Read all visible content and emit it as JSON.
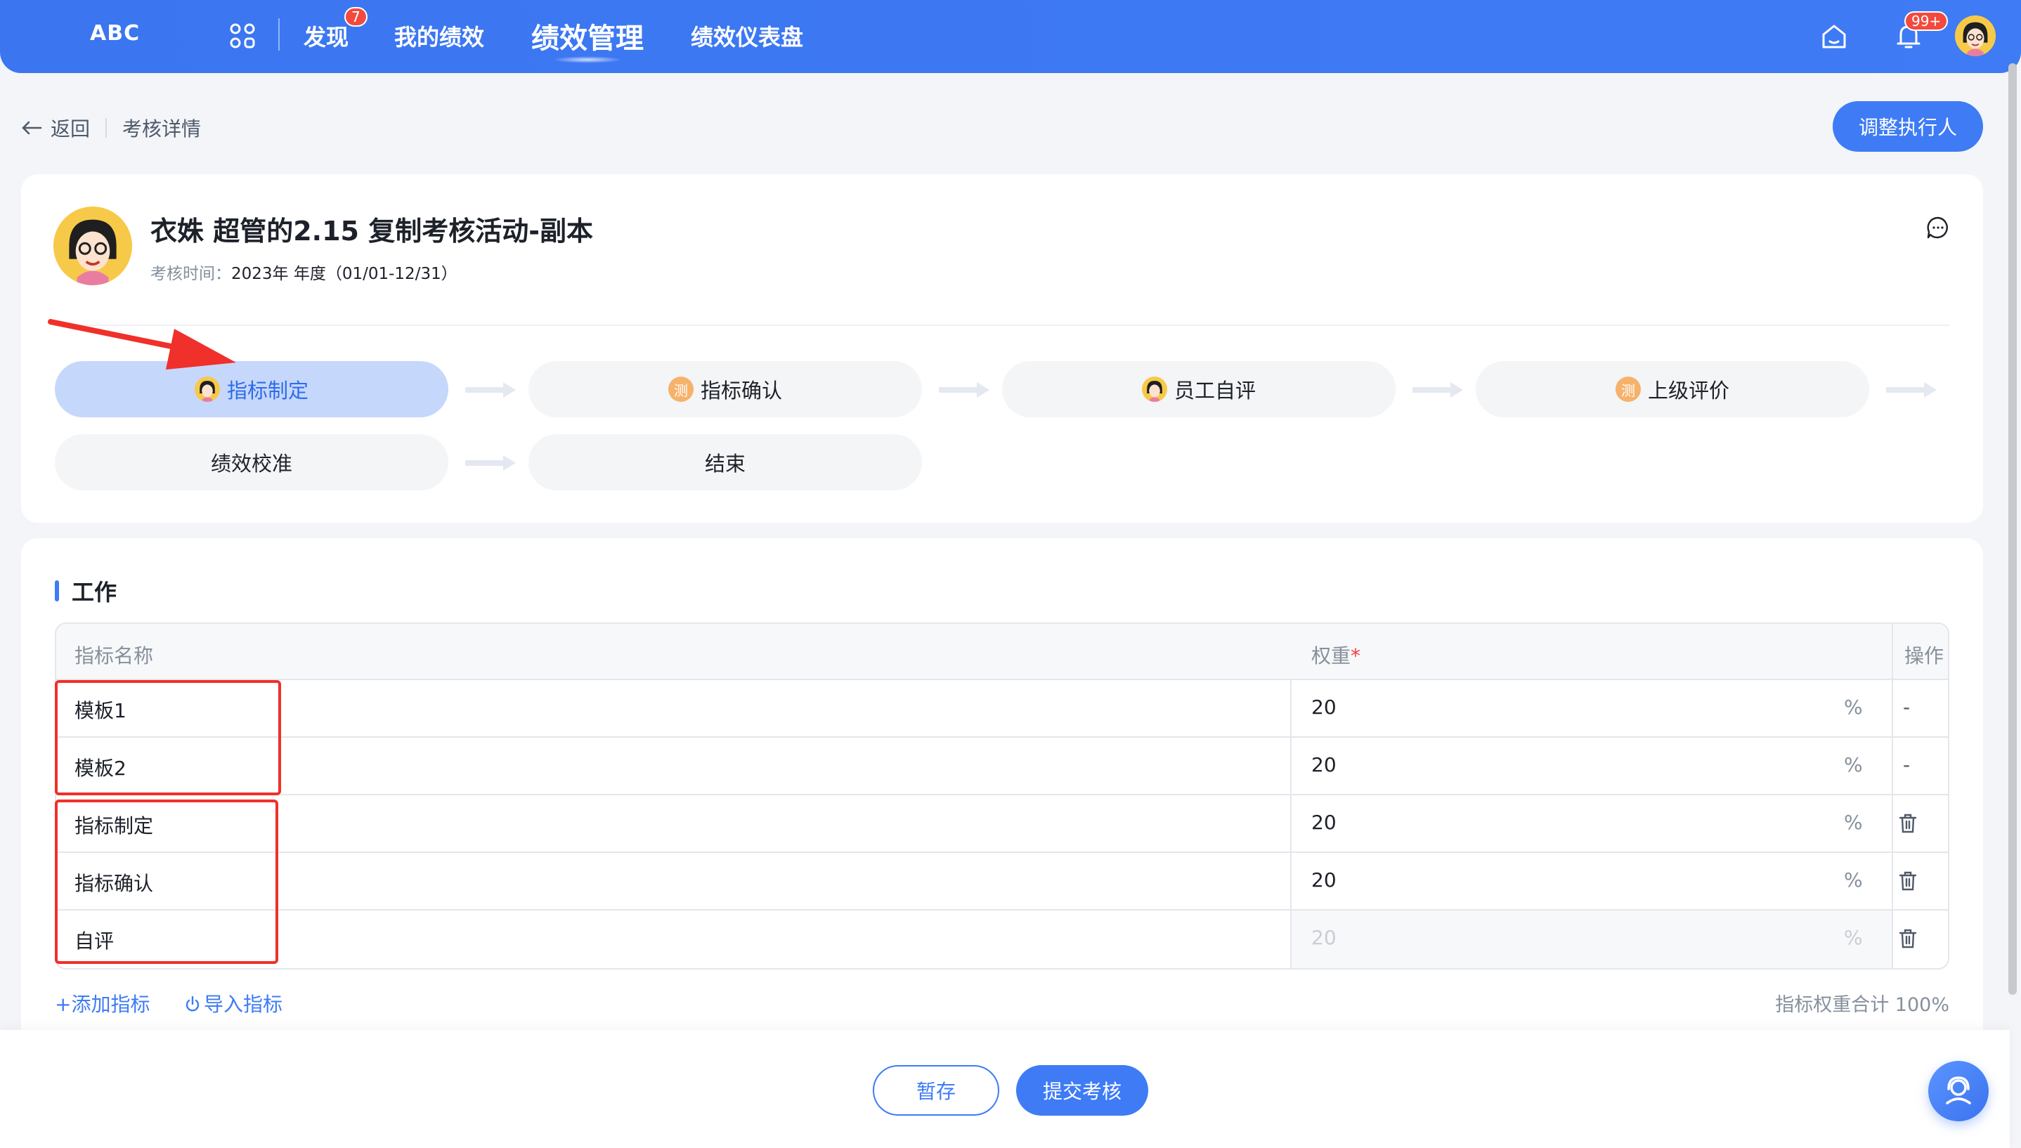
{
  "topnav": {
    "logo": "ABC",
    "items": [
      {
        "label": "发现",
        "badge": "7"
      },
      {
        "label": "我的绩效"
      },
      {
        "label": "绩效管理",
        "active": true
      },
      {
        "label": "绩效仪表盘"
      }
    ],
    "notification_badge": "99+",
    "icons": [
      "apps-icon",
      "home-icon",
      "bell-icon",
      "user-avatar"
    ]
  },
  "breadcrumb": {
    "back_label": "返回",
    "current": "考核详情"
  },
  "actions": {
    "adjust_executor": "调整执行人"
  },
  "review": {
    "title": "衣姝 超管的2.15 复制考核活动-副本",
    "time_label": "考核时间：",
    "time_value": "2023年 年度（01/01-12/31）"
  },
  "steps": [
    {
      "label": "指标制定",
      "icon": "avatar",
      "active": true
    },
    {
      "label": "指标确认",
      "icon": "测"
    },
    {
      "label": "员工自评",
      "icon": "avatar"
    },
    {
      "label": "上级评价",
      "icon": "测"
    },
    {
      "label": "绩效校准"
    },
    {
      "label": "结束"
    }
  ],
  "section": {
    "title": "工作",
    "columns": {
      "name": "指标名称",
      "weight": "权重",
      "weight_required": "*",
      "op": "操作"
    },
    "rows": [
      {
        "name": "模板1",
        "weight": "20",
        "unit": "%",
        "op": "-",
        "deletable": false
      },
      {
        "name": "模板2",
        "weight": "20",
        "unit": "%",
        "op": "-",
        "deletable": false
      },
      {
        "name": "指标制定",
        "weight": "20",
        "unit": "%",
        "deletable": true
      },
      {
        "name": "指标确认",
        "weight": "20",
        "unit": "%",
        "deletable": true
      },
      {
        "name": "自评",
        "weight": "20",
        "unit": "%",
        "deletable": true,
        "disabled": true
      }
    ],
    "add_label": "+添加指标",
    "import_label": "导入指标",
    "total_label": "指标权重合计 100%"
  },
  "footer": {
    "save_label": "暂存",
    "submit_label": "提交考核"
  },
  "colors": {
    "primary": "#3e7bf5",
    "highlight_red": "#f0302a",
    "badge_red": "#f24a3f"
  }
}
